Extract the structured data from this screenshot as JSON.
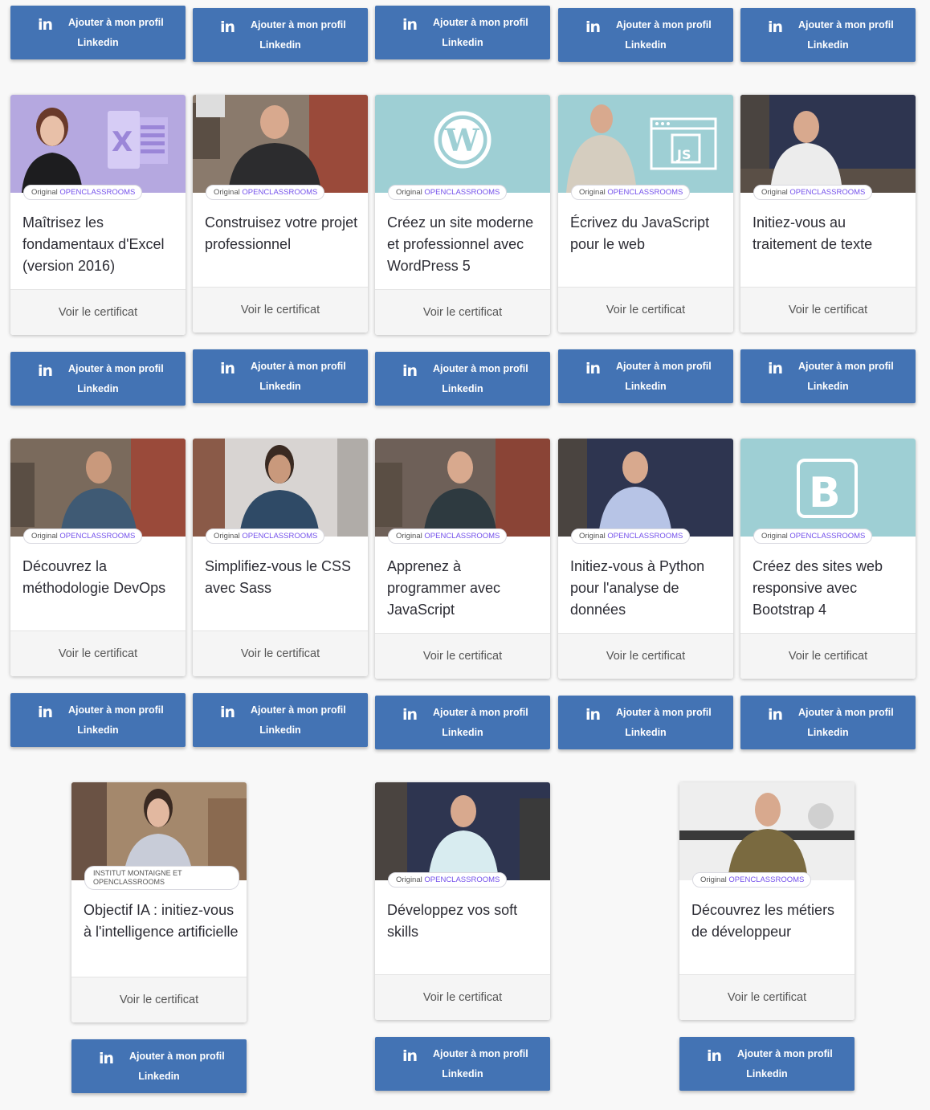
{
  "linkedin": {
    "line1": "Ajouter à mon profil",
    "line2": "Linkedin",
    "logo": "in"
  },
  "badge": {
    "prefix": "Original",
    "brand": "OPENCLASSROOMS"
  },
  "card_footer": "Voir le certificat",
  "colors": {
    "linkedin_button": "#4373b4",
    "brand_purple": "#7451eb",
    "thumb_teal": "#9ecfd4",
    "thumb_lavender": "#b5a8e0"
  },
  "courses": [
    {
      "title": "Maîtrisez les fondamentaux d'Excel (version 2016)",
      "thumb_icon": "excel-icon"
    },
    {
      "title": "Construisez votre projet professionnel",
      "thumb_icon": "instructor-photo"
    },
    {
      "title": "Créez un site moderne et professionnel avec WordPress 5",
      "thumb_icon": "wordpress-icon"
    },
    {
      "title": "Écrivez du JavaScript pour le web",
      "thumb_icon": "js-window-icon"
    },
    {
      "title": "Initiez-vous au traitement de texte",
      "thumb_icon": "instructor-photo"
    },
    {
      "title": "Découvrez la méthodologie DevOps",
      "thumb_icon": "instructor-photo"
    },
    {
      "title": "Simplifiez-vous le CSS avec Sass",
      "thumb_icon": "instructor-photo"
    },
    {
      "title": "Apprenez à programmer avec JavaScript",
      "thumb_icon": "instructor-photo"
    },
    {
      "title": "Initiez-vous à Python pour l'analyse de données",
      "thumb_icon": "instructor-photo"
    },
    {
      "title": "Créez des sites web responsive avec Bootstrap 4",
      "thumb_icon": "bootstrap-icon"
    },
    {
      "title": "Objectif IA : initiez-vous à l'intelligence artificielle",
      "thumb_icon": "instructor-photo",
      "badge_line1": "INSTITUT MONTAIGNE ET",
      "badge_line2": "OPENCLASSROOMS"
    },
    {
      "title": "Développez vos soft skills",
      "thumb_icon": "instructor-photo"
    },
    {
      "title": "Découvrez les métiers de développeur",
      "thumb_icon": "instructor-photo"
    }
  ]
}
